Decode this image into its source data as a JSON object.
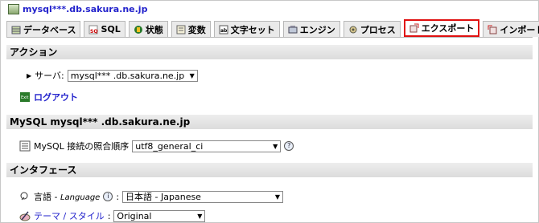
{
  "server": {
    "name": "mysql***.db.sakura.ne.jp"
  },
  "tabs": [
    {
      "label": "データベース"
    },
    {
      "label": "SQL"
    },
    {
      "label": "状態"
    },
    {
      "label": "変数"
    },
    {
      "label": "文字セット"
    },
    {
      "label": "エンジン"
    },
    {
      "label": "プロセス"
    },
    {
      "label": "エクスポート"
    },
    {
      "label": "インポート"
    }
  ],
  "actions": {
    "heading": "アクション",
    "server_label": "サーバ:",
    "server_value": "mysql*** .db.sakura.ne.jp",
    "logout": "ログアウト"
  },
  "mysql": {
    "heading": "MySQL mysql*** .db.sakura.ne.jp",
    "collation_label": "MySQL 接続の照合順序",
    "collation_value": "utf8_general_ci"
  },
  "interface": {
    "heading": "インタフェース",
    "language_label": "言語 - ",
    "language_label_en": "Language",
    "language_value": "日本語 - Japanese",
    "theme_link": "テーマ / スタイル",
    "theme_sep": ":",
    "theme_value": "Original"
  },
  "colors": {
    "active_tab_border": "#e01010",
    "link": "#2222cc"
  }
}
